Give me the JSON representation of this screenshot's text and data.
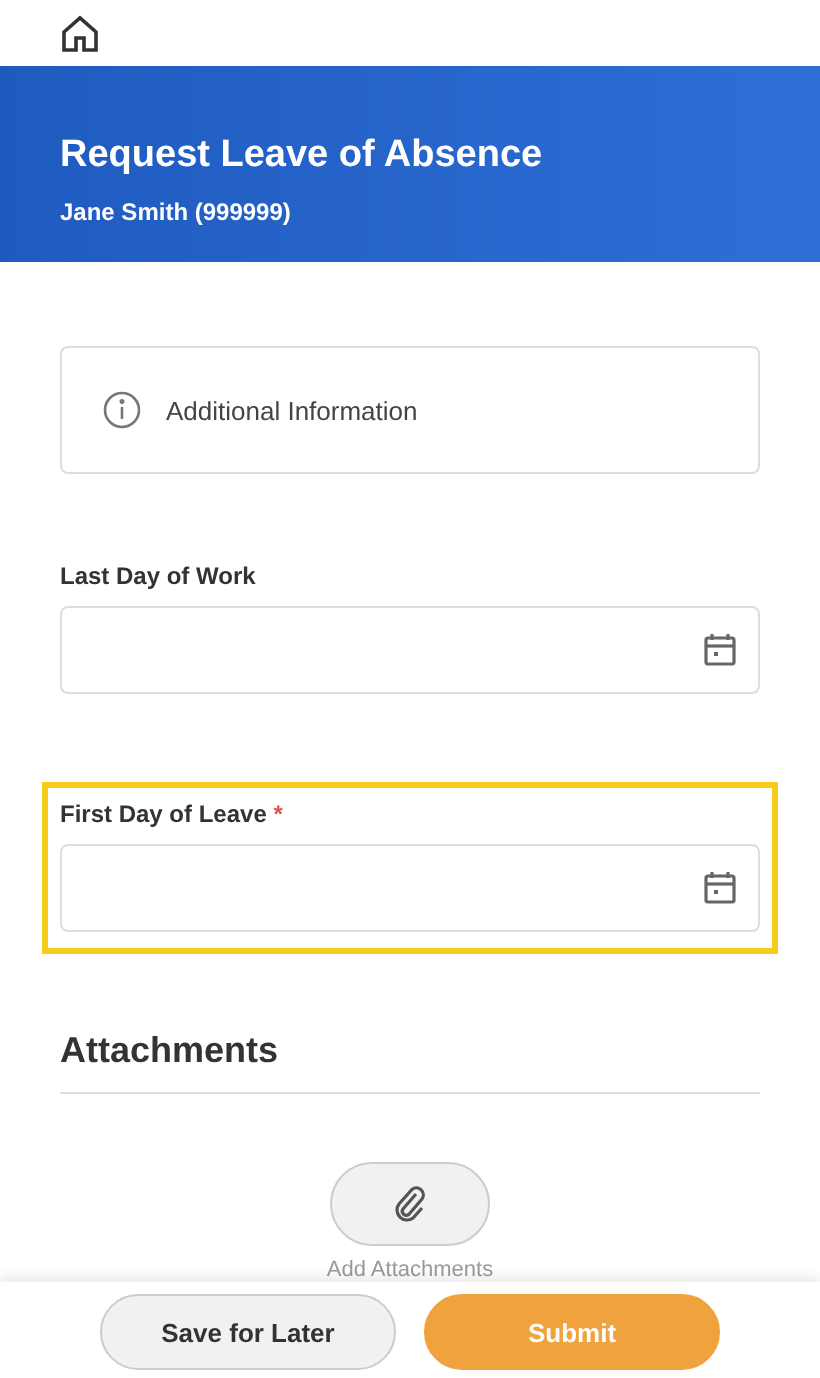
{
  "header": {
    "title": "Request Leave of Absence",
    "subtitle": "Jane Smith (999999)"
  },
  "info_card": {
    "text": "Additional Information"
  },
  "fields": [
    {
      "label": "Last Day of Work",
      "highlighted": false
    },
    {
      "label": "First Day of Leave",
      "required_mark": "*",
      "highlighted": true
    }
  ],
  "attachments": {
    "heading": "Attachments",
    "action_label": "Add Attachments"
  },
  "buttons": [
    {
      "label": "Save for Later",
      "kind": "secondary"
    },
    {
      "label": "Submit",
      "kind": "primary"
    }
  ]
}
